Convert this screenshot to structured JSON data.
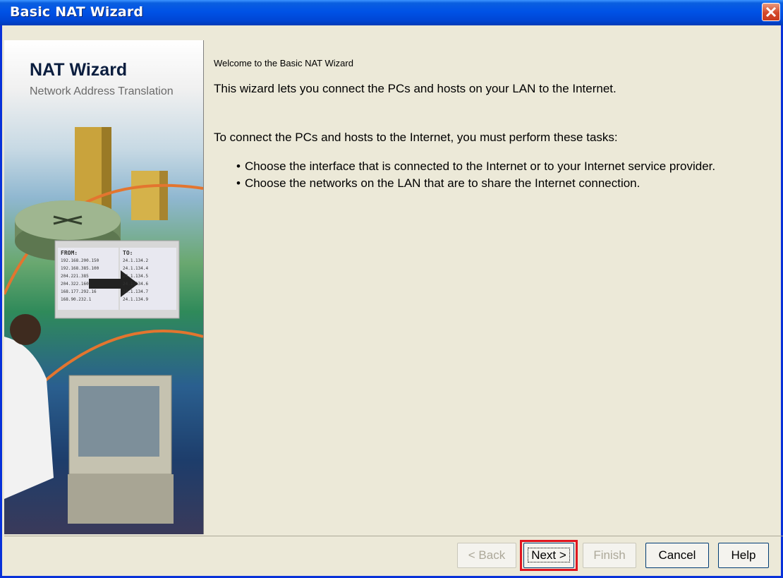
{
  "window": {
    "title": "Basic NAT Wizard"
  },
  "banner": {
    "title": "NAT Wizard",
    "subtitle": "Network Address Translation"
  },
  "content": {
    "welcome": "Welcome to the Basic NAT Wizard",
    "intro": "This wizard lets you connect the PCs and hosts on your LAN to the Internet.",
    "tasks_intro": "To connect the PCs and hosts to the Internet, you must perform these tasks:",
    "tasks": [
      "Choose the interface that is connected to the Internet or to your Internet service provider.",
      "Choose the networks on the LAN that are to share the Internet connection."
    ]
  },
  "buttons": {
    "back": "< Back",
    "next": "Next >",
    "finish": "Finish",
    "cancel": "Cancel",
    "help": "Help"
  },
  "banner_graphic": {
    "table_from_header": "FROM:",
    "table_to_header": "TO:",
    "from": [
      "192.168.200.150",
      "192.168.385.100",
      "204.221.385",
      "204.322.160",
      "168.177.292.16",
      "168.90.232.1"
    ],
    "to": [
      "24.1.134.2",
      "24.1.134.4",
      "24.1.134.5",
      "24.1.134.6",
      "24.1.134.7",
      "24.1.134.9"
    ]
  },
  "colors": {
    "title_bar": "#0052e6",
    "highlight": "#e0151f",
    "background": "#ece9d8"
  }
}
